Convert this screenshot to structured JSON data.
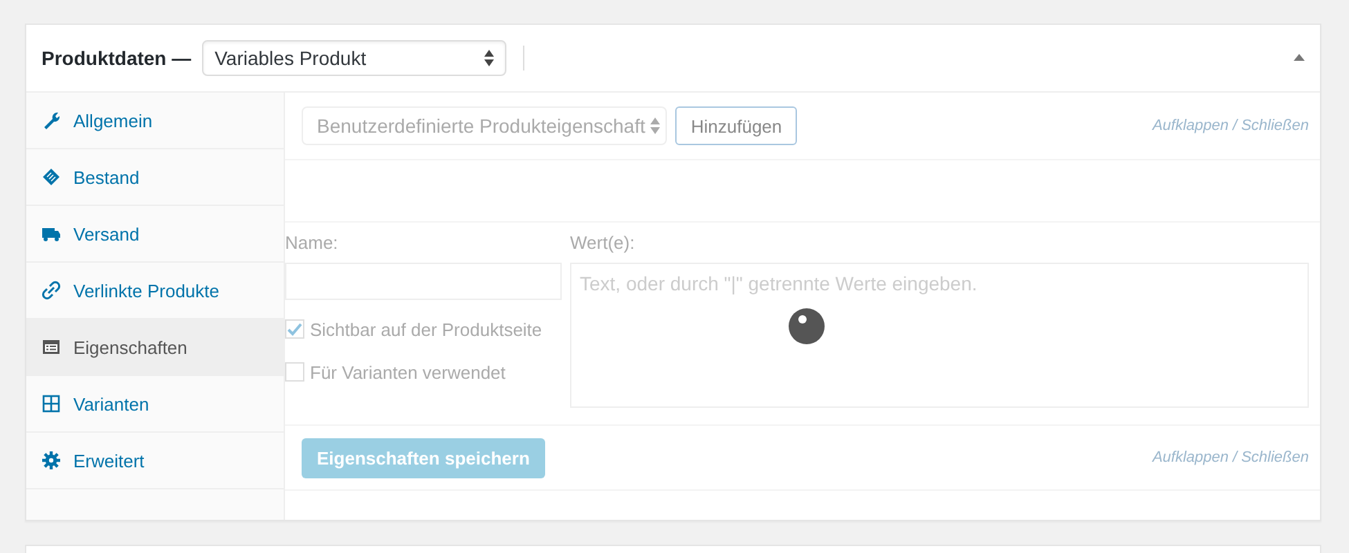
{
  "panel": {
    "title": "Produktdaten —",
    "product_type": "Variables Produkt",
    "expanded": true
  },
  "tabs": [
    {
      "label": "Allgemein",
      "selected": false
    },
    {
      "label": "Bestand",
      "selected": false
    },
    {
      "label": "Versand",
      "selected": false
    },
    {
      "label": "Verlinkte Produkte",
      "selected": false
    },
    {
      "label": "Eigenschaften",
      "selected": true
    },
    {
      "label": "Varianten",
      "selected": false
    },
    {
      "label": "Erweitert",
      "selected": false
    }
  ],
  "toolbar": {
    "attribute_select": "Benutzerdefinierte Produkteigenschaft",
    "add_button": "Hinzufügen",
    "expand_link": "Aufklappen",
    "separator": "/",
    "close_link": "Schließen"
  },
  "attribute": {
    "name_label": "Name:",
    "values_label": "Wert(e):",
    "values_placeholder": "Text, oder durch \"|\" getrennte Werte eingeben.",
    "loading": true,
    "options": [
      {
        "label": "Sichtbar auf der Produktseite",
        "checked": true
      },
      {
        "label": "Für Varianten verwendet",
        "checked": false
      }
    ]
  },
  "footer": {
    "save_button": "Eigenschaften speichern",
    "expand_link": "Aufklappen",
    "separator": "/",
    "close_link": "Schließen"
  }
}
